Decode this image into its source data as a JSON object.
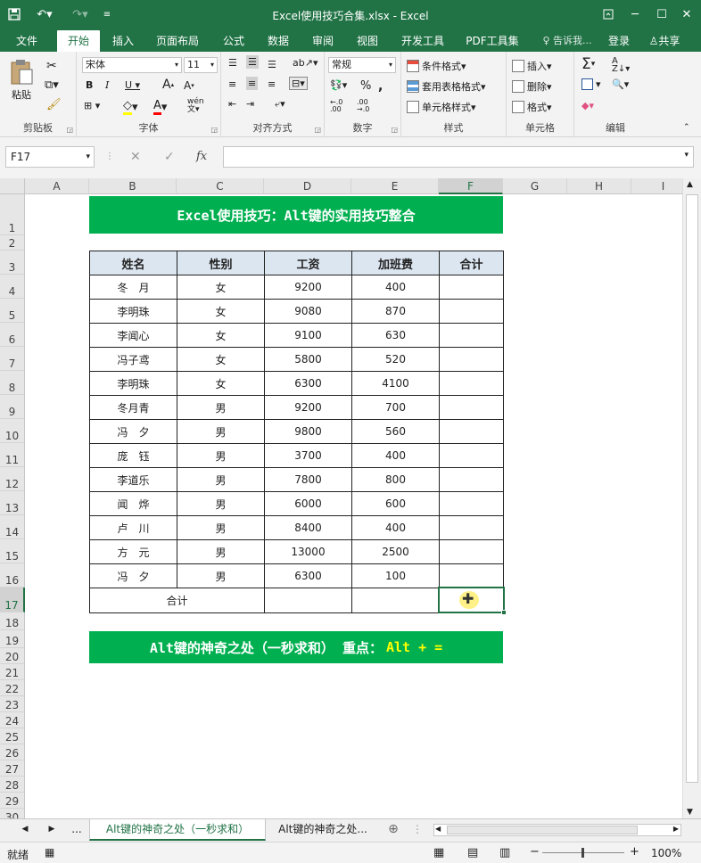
{
  "window": {
    "title": "Excel使用技巧合集.xlsx - Excel"
  },
  "tabs": [
    {
      "label": "文件"
    },
    {
      "label": "开始"
    },
    {
      "label": "插入"
    },
    {
      "label": "页面布局"
    },
    {
      "label": "公式"
    },
    {
      "label": "数据"
    },
    {
      "label": "审阅"
    },
    {
      "label": "视图"
    },
    {
      "label": "开发工具"
    },
    {
      "label": "PDF工具集"
    }
  ],
  "tell_me": "告诉我...",
  "login": "登录",
  "share": "共享",
  "ribbon": {
    "paste": "粘贴",
    "font_name": "宋体",
    "font_size": "11",
    "number_format": "常规",
    "cond_format": "条件格式",
    "table_format": "套用表格格式",
    "cell_style": "单元格样式",
    "insert": "插入",
    "delete": "删除",
    "format": "格式",
    "groups": {
      "clipboard": "剪贴板",
      "font": "字体",
      "align": "对齐方式",
      "number": "数字",
      "style": "样式",
      "cells": "单元格",
      "edit": "编辑"
    }
  },
  "name_box": "F17",
  "columns": [
    "A",
    "B",
    "C",
    "D",
    "E",
    "F",
    "G",
    "H",
    "I"
  ],
  "rows": [
    "1",
    "2",
    "3",
    "4",
    "5",
    "6",
    "7",
    "8",
    "9",
    "10",
    "11",
    "12",
    "13",
    "14",
    "15",
    "16",
    "17",
    "18",
    "19",
    "20",
    "21",
    "22",
    "23",
    "24",
    "25",
    "26",
    "27",
    "28",
    "29",
    "30"
  ],
  "sheet": {
    "banner1": "Excel使用技巧：Alt键的实用技巧整合",
    "banner2_a": "Alt键的神奇之处（一秒求和） 重点：",
    "banner2_b": "Alt + =",
    "headers": [
      "姓名",
      "性别",
      "工资",
      "加班费",
      "合计"
    ],
    "data": [
      [
        "冬　月",
        "女",
        "9200",
        "400",
        ""
      ],
      [
        "李明珠",
        "女",
        "9080",
        "870",
        ""
      ],
      [
        "李闻心",
        "女",
        "9100",
        "630",
        ""
      ],
      [
        "冯子鸢",
        "女",
        "5800",
        "520",
        ""
      ],
      [
        "李明珠",
        "女",
        "6300",
        "4100",
        ""
      ],
      [
        "冬月青",
        "男",
        "9200",
        "700",
        ""
      ],
      [
        "冯　夕",
        "男",
        "9800",
        "560",
        ""
      ],
      [
        "庞　钰",
        "男",
        "3700",
        "400",
        ""
      ],
      [
        "李道乐",
        "男",
        "7800",
        "800",
        ""
      ],
      [
        "闻　烨",
        "男",
        "6000",
        "600",
        ""
      ],
      [
        "卢　川",
        "男",
        "8400",
        "400",
        ""
      ],
      [
        "方　元",
        "男",
        "13000",
        "2500",
        ""
      ],
      [
        "冯　夕",
        "男",
        "6300",
        "100",
        ""
      ]
    ],
    "total_label": "合计"
  },
  "sheet_tabs": [
    "Alt键的神奇之处（一秒求和）",
    "Alt键的神奇之处"
  ],
  "status": {
    "ready": "就绪",
    "zoom": "100%"
  },
  "colors": {
    "excel_green": "#217346",
    "banner_green": "#00b050",
    "header_fill": "#dce6f1",
    "highlight_yellow": "#ffff00"
  }
}
